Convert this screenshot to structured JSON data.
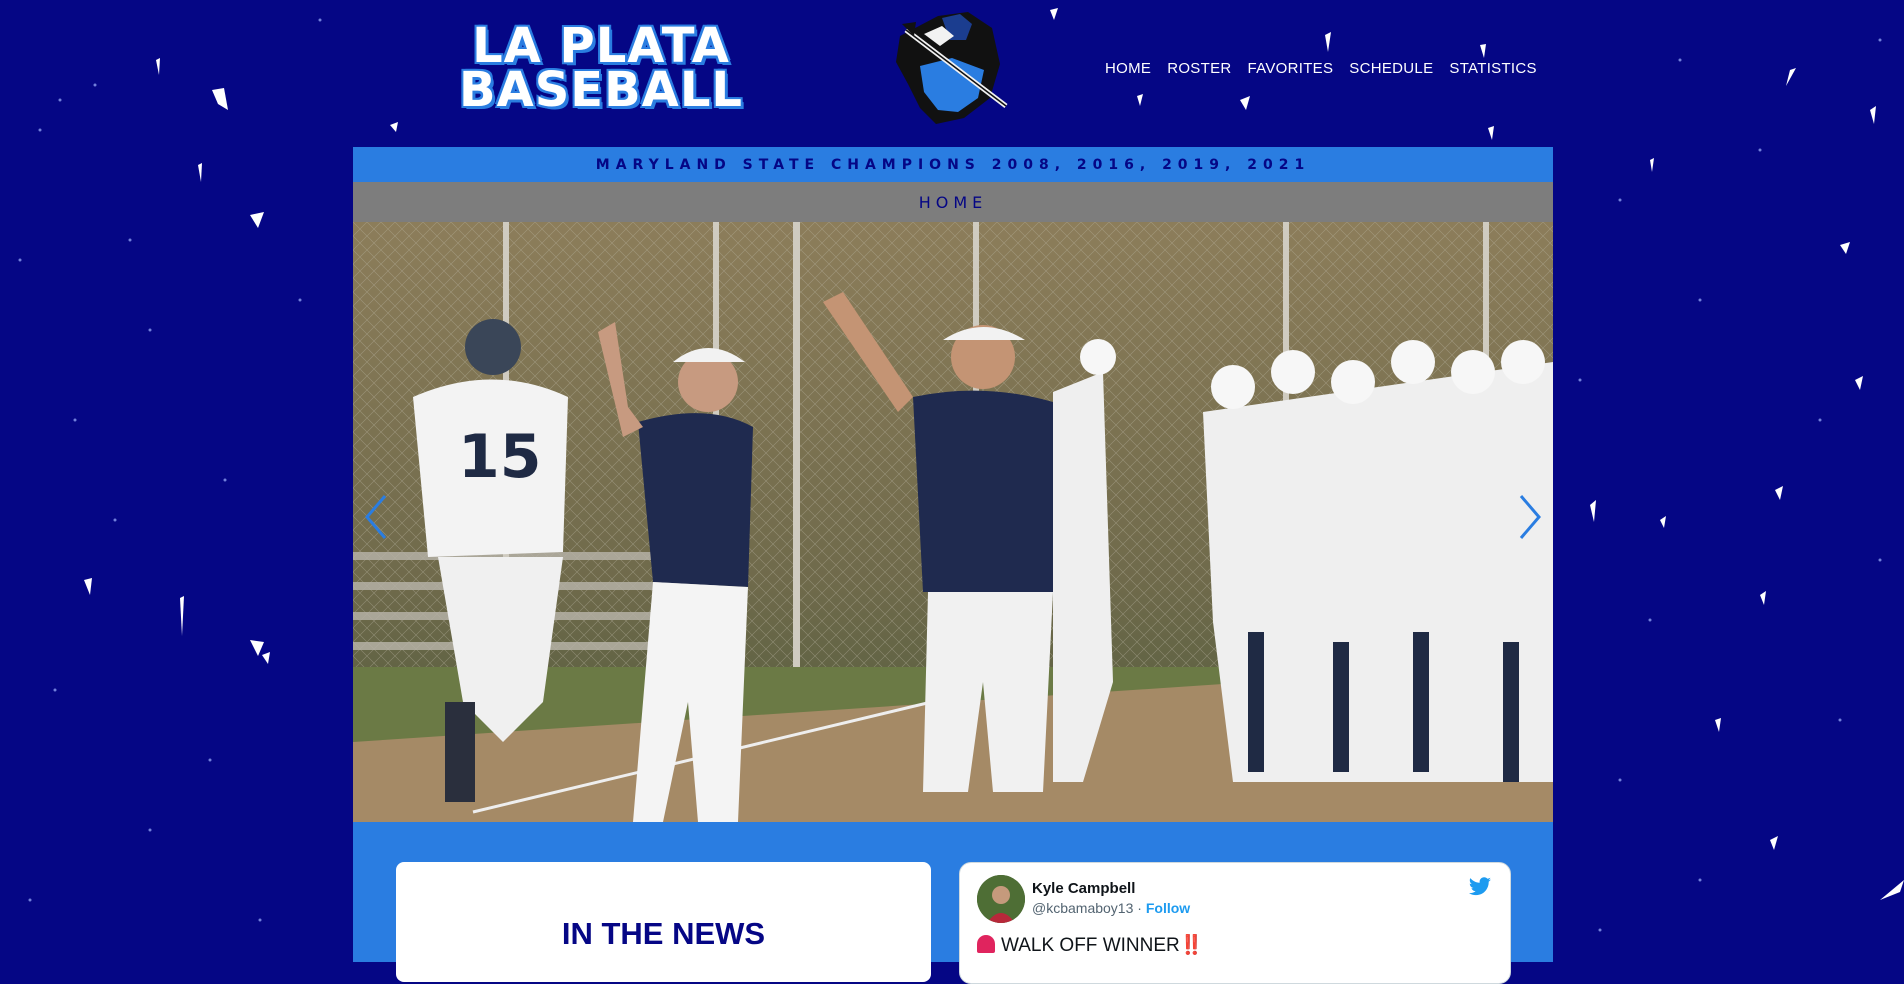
{
  "header": {
    "title_line1": "LA PLATA",
    "title_line2": "BASEBALL",
    "logo_icon": "knight-mascot-icon"
  },
  "nav": {
    "items": [
      {
        "label": "HOME"
      },
      {
        "label": "ROSTER"
      },
      {
        "label": "FAVORITES"
      },
      {
        "label": "SCHEDULE"
      },
      {
        "label": "STATISTICS"
      }
    ]
  },
  "banner": {
    "text": "MARYLAND STATE CHAMPIONS 2008, 2016, 2019, 2021"
  },
  "page": {
    "heading": "HOME"
  },
  "slideshow": {
    "image_icon": "team-celebration-photo",
    "prev_icon": "chevron-left-icon",
    "next_icon": "chevron-right-icon"
  },
  "news": {
    "title": "IN THE NEWS"
  },
  "tweet": {
    "name": "Kyle Campbell",
    "handle": "@kcbamaboy13",
    "separator": " · ",
    "follow_label": "Follow",
    "text": "WALK OFF WINNER",
    "text_suffix": "‼️"
  },
  "colors": {
    "background": "#050685",
    "accent": "#2a7de1",
    "subhead": "#7d7d7d"
  }
}
